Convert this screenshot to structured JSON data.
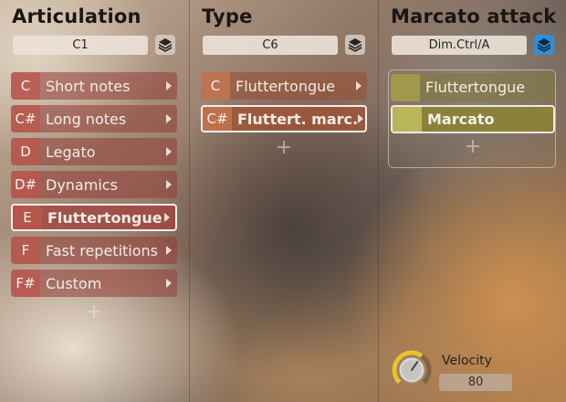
{
  "columns": [
    {
      "title": "Articulation",
      "key_field": "C1",
      "layers_active": false,
      "rows": [
        {
          "key": "C",
          "label": "Short notes",
          "selected": false
        },
        {
          "key": "C#",
          "label": "Long notes",
          "selected": false
        },
        {
          "key": "D",
          "label": "Legato",
          "selected": false
        },
        {
          "key": "D#",
          "label": "Dynamics",
          "selected": false
        },
        {
          "key": "E",
          "label": "Fluttertongue",
          "selected": true
        },
        {
          "key": "F",
          "label": "Fast repetitions",
          "selected": false
        },
        {
          "key": "F#",
          "label": "Custom",
          "selected": false
        }
      ],
      "add_label": "+"
    },
    {
      "title": "Type",
      "key_field": "C6",
      "layers_active": false,
      "rows": [
        {
          "key": "C",
          "label": "Fluttertongue",
          "selected": false
        },
        {
          "key": "C#",
          "label": "Fluttert. marc.",
          "selected": true
        }
      ],
      "add_label": "+"
    },
    {
      "title": "Marcato attack",
      "key_field": "Dim.Ctrl/A",
      "layers_active": true,
      "rows": [
        {
          "key": "",
          "label": "Fluttertongue",
          "selected": false
        },
        {
          "key": "",
          "label": "Marcato",
          "selected": true
        }
      ],
      "add_label": "+"
    }
  ],
  "velocity": {
    "label": "Velocity",
    "value": "80",
    "level": 0.63
  },
  "colors": {
    "layers_active": "#2f8fd8",
    "knob_ring": "#e8c32a"
  },
  "icons": {
    "layers": "layers-icon",
    "chevron": "chevron-right-icon",
    "knob": "velocity-knob"
  }
}
